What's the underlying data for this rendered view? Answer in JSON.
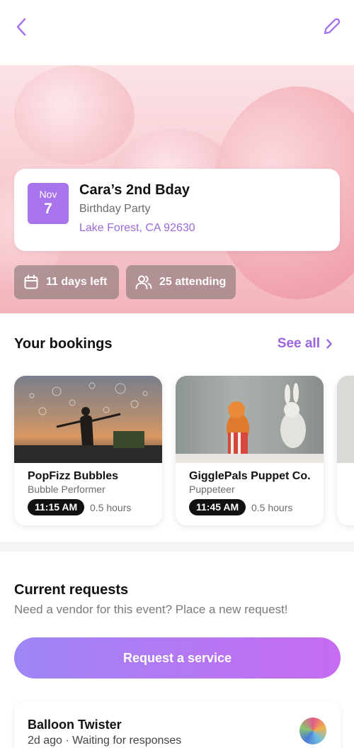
{
  "header": {
    "back_icon": "chevron-left-icon",
    "edit_icon": "pencil-icon",
    "accent_color": "#a874ee"
  },
  "event": {
    "month": "Nov",
    "day": "7",
    "title": "Cara’s 2nd Bday",
    "type": "Birthday Party",
    "location": "Lake Forest, CA 92630"
  },
  "chips": {
    "days_left": "11 days left",
    "attending": "25 attending"
  },
  "bookings": {
    "title": "Your bookings",
    "see_all": "See all",
    "items": [
      {
        "name": "PopFizz Bubbles",
        "role": "Bubble Performer",
        "time": "11:15 AM",
        "duration": "0.5 hours"
      },
      {
        "name": "GigglePals Puppet Co.",
        "role": "Puppeteer",
        "time": "11:45 AM",
        "duration": "0.5 hours"
      }
    ]
  },
  "requests": {
    "title": "Current requests",
    "subtitle": "Need a vendor for this event? Place a new request!",
    "button_label": "Request a service",
    "items": [
      {
        "name": "Balloon Twister",
        "status": "2d ago · Waiting for responses"
      }
    ]
  }
}
